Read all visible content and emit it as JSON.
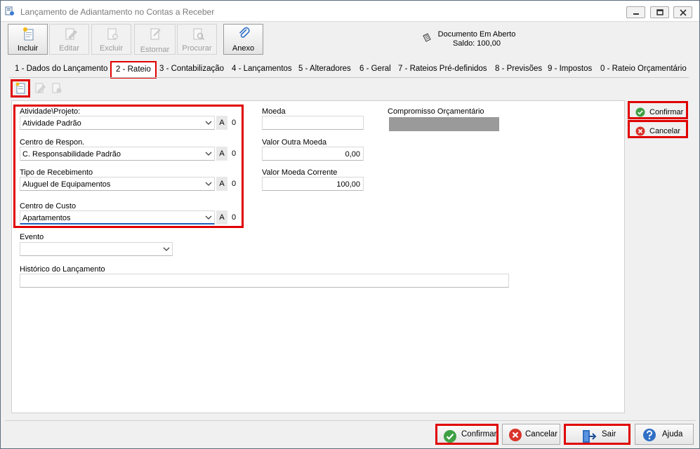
{
  "window": {
    "title": "Lançamento de Adiantamento no Contas a Receber"
  },
  "toolbar": {
    "buttons": [
      {
        "label": "Incluir",
        "icon": "new-document-icon",
        "enabled": true
      },
      {
        "label": "Editar",
        "icon": "edit-icon",
        "enabled": false
      },
      {
        "label": "Excluir",
        "icon": "delete-icon",
        "enabled": false
      },
      {
        "label": "Estornar",
        "icon": "reverse-icon",
        "enabled": false
      },
      {
        "label": "Procurar",
        "icon": "search-icon",
        "enabled": false
      },
      {
        "label": "Anexo",
        "icon": "paperclip-icon",
        "enabled": true
      }
    ]
  },
  "status": {
    "line1": "Documento Em Aberto",
    "line2": "Saldo: 100,00"
  },
  "tabs": [
    "1 - Dados do Lançamento",
    "2 - Rateio",
    "3 - Contabilização",
    "4 - Lançamentos",
    "5 - Alteradores",
    "6 - Geral",
    "7 - Rateios Pré-definidos",
    "8 - Previsões",
    "9 - Impostos",
    "0 - Rateio Orçamentário"
  ],
  "selected_tab": "2 - Rateio",
  "form": {
    "atividade": {
      "label": "Atividade\\Projeto:",
      "value": "Atividade Padrão",
      "badge": "A",
      "count": "0"
    },
    "centro_respon": {
      "label": "Centro de Respon.",
      "value": "C. Responsabilidade Padrão",
      "badge": "A",
      "count": "0"
    },
    "tipo_recebimento": {
      "label": "Tipo de Recebimento",
      "value": "Aluguel de Equipamentos",
      "badge": "A",
      "count": "0"
    },
    "centro_custo": {
      "label": "Centro de Custo",
      "value": "Apartamentos",
      "badge": "A",
      "count": "0"
    },
    "evento": {
      "label": "Evento",
      "value": ""
    },
    "historico": {
      "label": "Histórico do Lançamento",
      "value": ""
    },
    "moeda": {
      "label": "Moeda",
      "value": ""
    },
    "valor_outra_moeda": {
      "label": "Valor Outra Moeda",
      "value": "0,00"
    },
    "valor_moeda_corrente": {
      "label": "Valor Moeda Corrente",
      "value": "100,00"
    },
    "compromisso": {
      "label": "Compromisso Orçamentário",
      "value": ""
    }
  },
  "side_buttons": {
    "confirmar": "Confirmar",
    "cancelar": "Cancelar"
  },
  "bottom_buttons": {
    "confirmar": "Confirmar",
    "cancelar": "Cancelar",
    "sair": "Sair",
    "ajuda": "Ajuda"
  },
  "colors": {
    "highlight": "#e00000",
    "confirm_green": "#3ea043",
    "cancel_red": "#d9342b",
    "focus_blue": "#1f5fbf"
  }
}
